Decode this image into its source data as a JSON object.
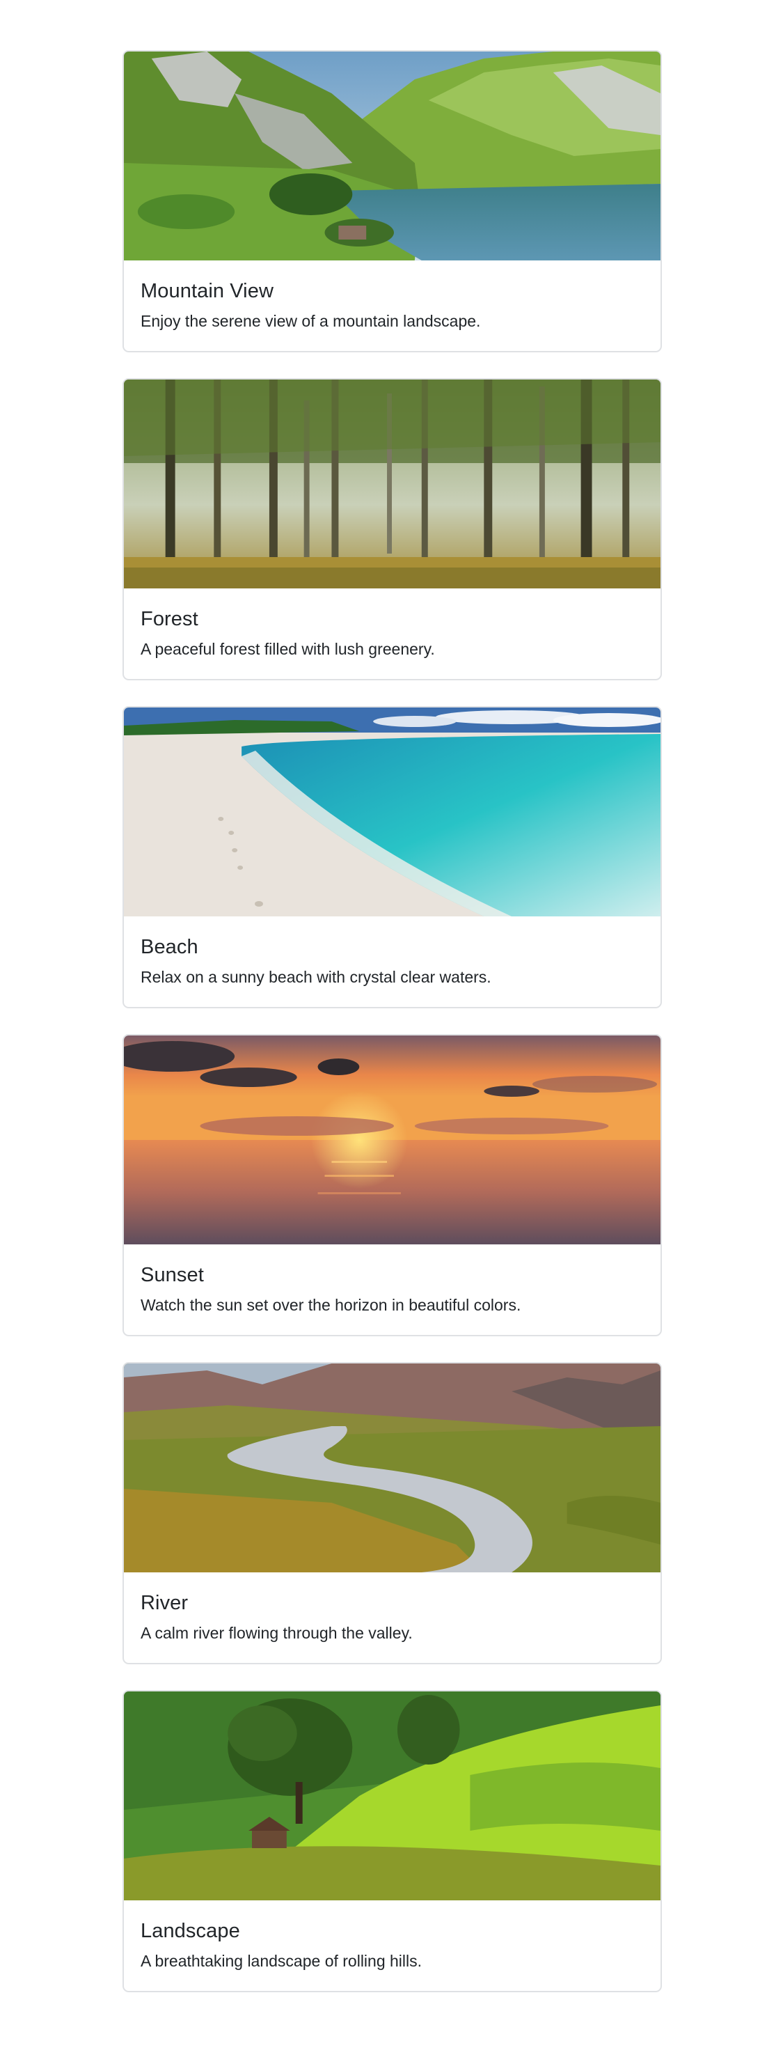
{
  "cards": [
    {
      "title": "Mountain View",
      "text": "Enjoy the serene view of a mountain landscape.",
      "image": "mountain-lake-photo"
    },
    {
      "title": "Forest",
      "text": "A peaceful forest filled with lush greenery.",
      "image": "forest-photo"
    },
    {
      "title": "Beach",
      "text": "Relax on a sunny beach with crystal clear waters.",
      "image": "beach-photo"
    },
    {
      "title": "Sunset",
      "text": "Watch the sun set over the horizon in beautiful colors.",
      "image": "sunset-photo"
    },
    {
      "title": "River",
      "text": "A calm river flowing through the valley.",
      "image": "river-photo"
    },
    {
      "title": "Landscape",
      "text": "A breathtaking landscape of rolling hills.",
      "image": "landscape-photo"
    }
  ]
}
